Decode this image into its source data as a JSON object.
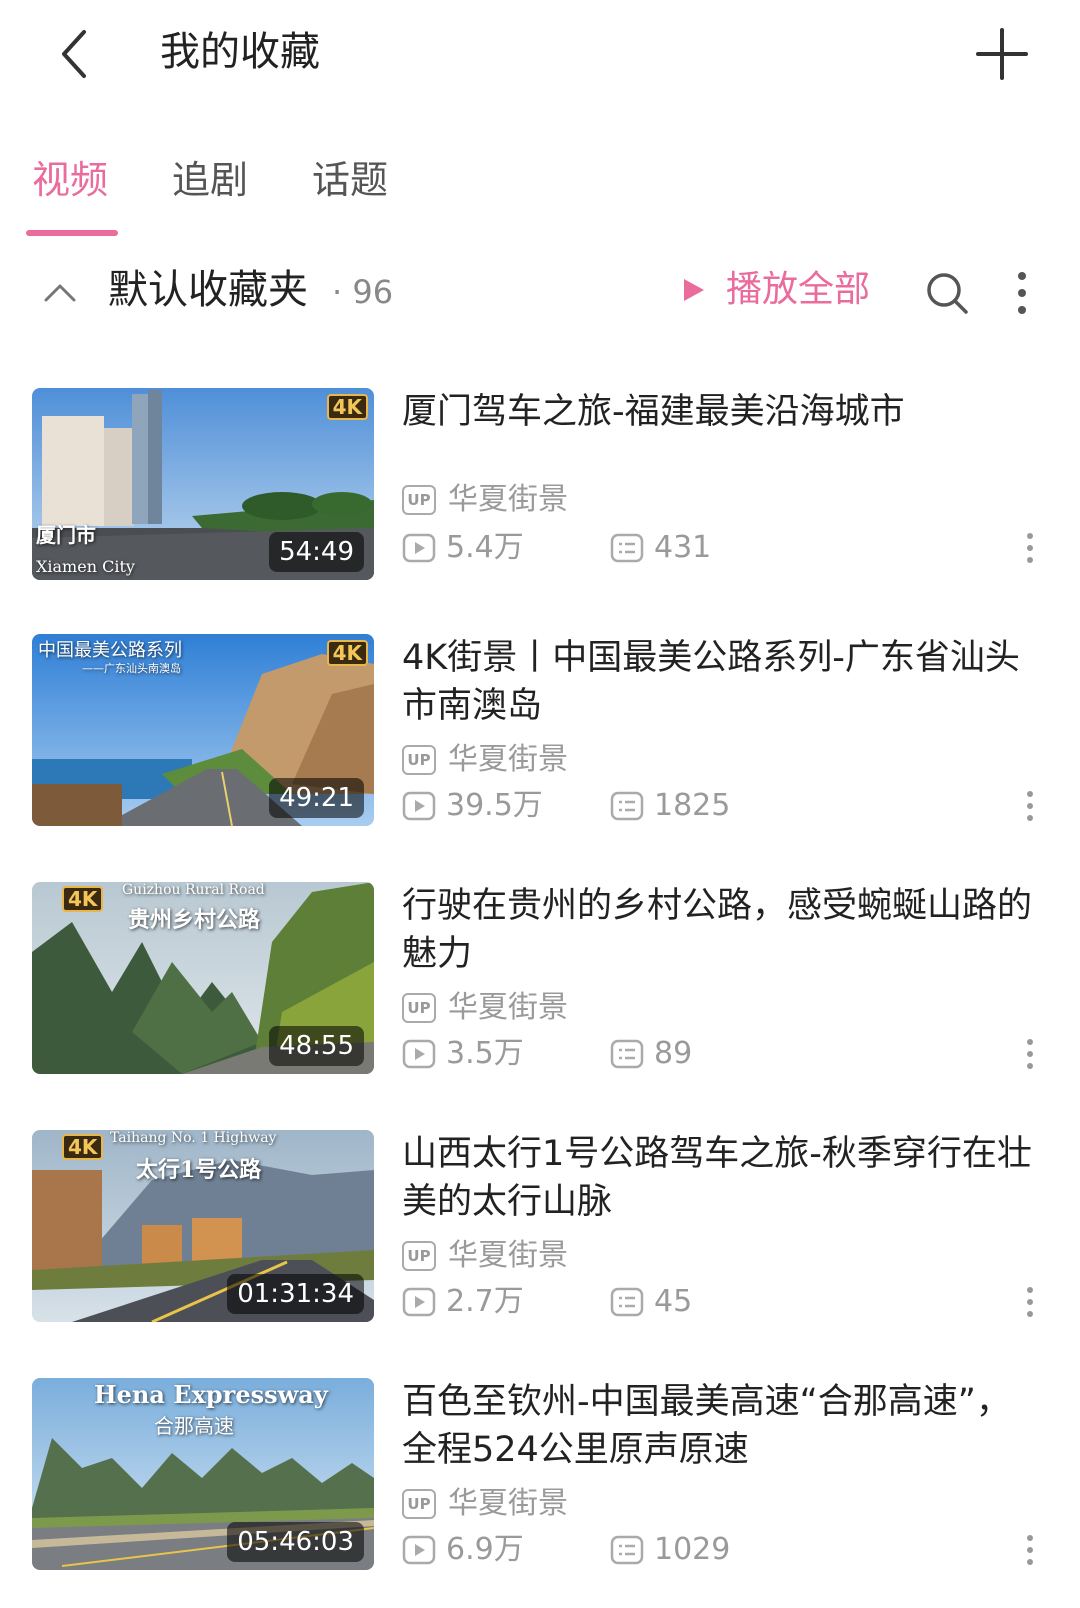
{
  "header": {
    "title": "我的收藏"
  },
  "tabs": [
    {
      "label": "视频",
      "active": true
    },
    {
      "label": "追剧",
      "active": false
    },
    {
      "label": "话题",
      "active": false
    }
  ],
  "folder": {
    "name": "默认收藏夹",
    "count": "· 96",
    "play_all_label": "播放全部"
  },
  "colors": {
    "accent": "#ea6c9d",
    "meta": "#9a9a9a"
  },
  "videos": [
    {
      "title": "厦门驾车之旅-福建最美沿海城市",
      "author": "华夏街景",
      "views": "5.4万",
      "comments": "431",
      "duration": "54:49",
      "badge": "4K",
      "caption_main": "厦门市",
      "caption_sub": "Xiamen City"
    },
    {
      "title": "4K街景丨中国最美公路系列-广东省汕头市南澳岛",
      "author": "华夏街景",
      "views": "39.5万",
      "comments": "1825",
      "duration": "49:21",
      "badge": "4K",
      "caption_main": "中国最美公路系列",
      "caption_sub": "——广东汕头南澳岛"
    },
    {
      "title": "行驶在贵州的乡村公路，感受蜿蜒山路的魅力",
      "author": "华夏街景",
      "views": "3.5万",
      "comments": "89",
      "duration": "48:55",
      "badge": "4K",
      "caption_main": "贵州乡村公路",
      "caption_sub": "Guizhou Rural Road"
    },
    {
      "title": "山西太行1号公路驾车之旅-秋季穿行在壮美的太行山脉",
      "author": "华夏街景",
      "views": "2.7万",
      "comments": "45",
      "duration": "01:31:34",
      "badge": "4K",
      "caption_main": "太行1号公路",
      "caption_sub": "Taihang No. 1 Highway"
    },
    {
      "title": "百色至钦州-中国最美高速“合那高速”，全程524公里原声原速",
      "author": "华夏街景",
      "views": "6.9万",
      "comments": "1029",
      "duration": "05:46:03",
      "badge": "",
      "caption_main": "合那高速",
      "caption_sub": "Hena Expressway"
    }
  ]
}
